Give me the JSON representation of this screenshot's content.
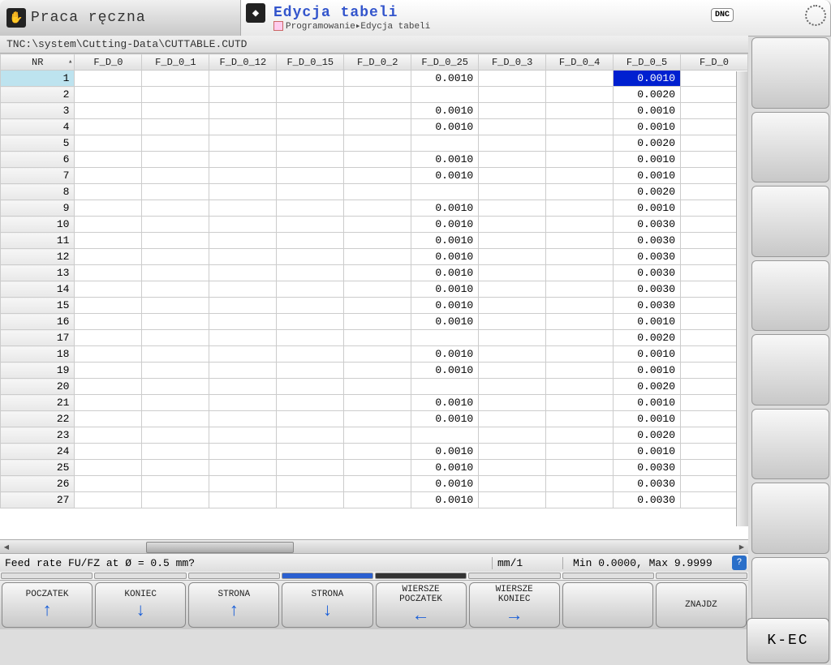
{
  "tabs": {
    "left_title": "Praca ręczna",
    "right_title": "Edycja tabeli",
    "breadcrumb": "Programowanie▸Edycja tabeli"
  },
  "dnc": "DNC",
  "path": "TNC:\\system\\Cutting-Data\\CUTTABLE.CUTD",
  "columns": [
    "NR",
    "F_D_0",
    "F_D_0_1",
    "F_D_0_12",
    "F_D_0_15",
    "F_D_0_2",
    "F_D_0_25",
    "F_D_0_3",
    "F_D_0_4",
    "F_D_0_5",
    "F_D_0"
  ],
  "rows": [
    {
      "nr": "1",
      "c6": "0.0010",
      "c9": "0.0010",
      "sel": true
    },
    {
      "nr": "2",
      "c6": "",
      "c9": "0.0020"
    },
    {
      "nr": "3",
      "c6": "0.0010",
      "c9": "0.0010"
    },
    {
      "nr": "4",
      "c6": "0.0010",
      "c9": "0.0010"
    },
    {
      "nr": "5",
      "c6": "",
      "c9": "0.0020"
    },
    {
      "nr": "6",
      "c6": "0.0010",
      "c9": "0.0010"
    },
    {
      "nr": "7",
      "c6": "0.0010",
      "c9": "0.0010"
    },
    {
      "nr": "8",
      "c6": "",
      "c9": "0.0020"
    },
    {
      "nr": "9",
      "c6": "0.0010",
      "c9": "0.0010"
    },
    {
      "nr": "10",
      "c6": "0.0010",
      "c9": "0.0030"
    },
    {
      "nr": "11",
      "c6": "0.0010",
      "c9": "0.0030"
    },
    {
      "nr": "12",
      "c6": "0.0010",
      "c9": "0.0030"
    },
    {
      "nr": "13",
      "c6": "0.0010",
      "c9": "0.0030"
    },
    {
      "nr": "14",
      "c6": "0.0010",
      "c9": "0.0030"
    },
    {
      "nr": "15",
      "c6": "0.0010",
      "c9": "0.0030"
    },
    {
      "nr": "16",
      "c6": "0.0010",
      "c9": "0.0010"
    },
    {
      "nr": "17",
      "c6": "",
      "c9": "0.0020"
    },
    {
      "nr": "18",
      "c6": "0.0010",
      "c9": "0.0010"
    },
    {
      "nr": "19",
      "c6": "0.0010",
      "c9": "0.0010"
    },
    {
      "nr": "20",
      "c6": "",
      "c9": "0.0020"
    },
    {
      "nr": "21",
      "c6": "0.0010",
      "c9": "0.0010"
    },
    {
      "nr": "22",
      "c6": "0.0010",
      "c9": "0.0010"
    },
    {
      "nr": "23",
      "c6": "",
      "c9": "0.0020"
    },
    {
      "nr": "24",
      "c6": "0.0010",
      "c9": "0.0010"
    },
    {
      "nr": "25",
      "c6": "0.0010",
      "c9": "0.0030"
    },
    {
      "nr": "26",
      "c6": "0.0010",
      "c9": "0.0030"
    },
    {
      "nr": "27",
      "c6": "0.0010",
      "c9": "0.0030"
    }
  ],
  "status": {
    "prompt": "Feed rate FU/FZ at Ø = 0.5 mm?",
    "unit": "mm/1",
    "range": "Min 0.0000, Max 9.9999"
  },
  "softkeys": [
    {
      "l1": "POCZATEK",
      "arrow": "↑"
    },
    {
      "l1": "KONIEC",
      "arrow": "↓"
    },
    {
      "l1": "STRONA",
      "arrow": "↑"
    },
    {
      "l1": "STRONA",
      "arrow": "↓"
    },
    {
      "l1": "WIERSZE",
      "l2": "POCZATEK",
      "arrow": "←"
    },
    {
      "l1": "WIERSZE",
      "l2": "KONIEC",
      "arrow": "→"
    },
    {
      "l1": ""
    },
    {
      "l1": "ZNAJDZ"
    }
  ],
  "kec": "K-EC"
}
